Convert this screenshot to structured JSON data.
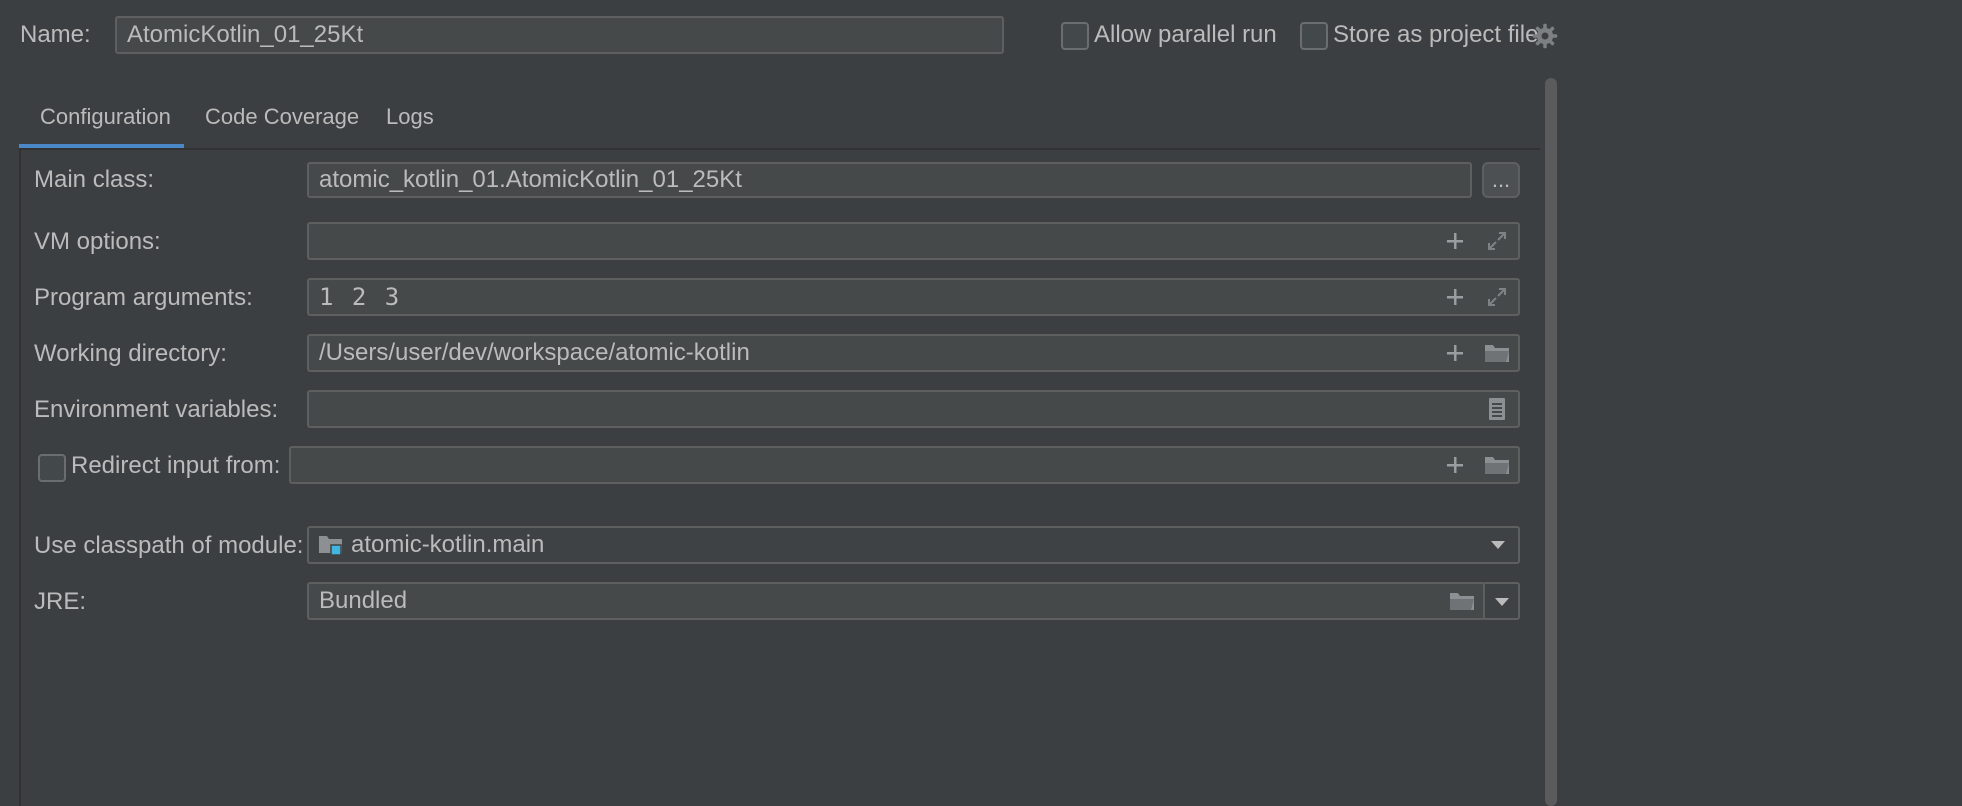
{
  "header": {
    "name_label": "Name:",
    "name_value": "AtomicKotlin_01_25Kt",
    "allow_parallel_label": "Allow parallel run",
    "store_project_label": "Store as project file"
  },
  "tabs": [
    {
      "label": "Configuration",
      "active": true
    },
    {
      "label": "Code Coverage",
      "active": false
    },
    {
      "label": "Logs",
      "active": false
    }
  ],
  "form": {
    "main_class": {
      "label": "Main class:",
      "value": "atomic_kotlin_01.AtomicKotlin_01_25Kt",
      "button": "..."
    },
    "vm_options": {
      "label": "VM options:",
      "value": ""
    },
    "program_arguments": {
      "label": "Program arguments:",
      "value": "1 2 3"
    },
    "working_directory": {
      "label": "Working directory:",
      "value": "/Users/user/dev/workspace/atomic-kotlin"
    },
    "environment_variables": {
      "label": "Environment variables:",
      "value": ""
    },
    "redirect_input": {
      "label": "Redirect input from:",
      "value": ""
    },
    "classpath_module": {
      "label": "Use classpath of module:",
      "value": "atomic-kotlin.main"
    },
    "jre": {
      "label": "JRE:",
      "value": "Bundled"
    }
  },
  "icons": {
    "plus": "plus-icon",
    "expand": "expand-icon",
    "folder": "folder-icon",
    "document": "document-icon",
    "chevron": "chevron-down-icon",
    "gear": "gear-icon",
    "module": "module-folder-icon"
  },
  "colors": {
    "background": "#3c3f41",
    "panel": "#3c3f41",
    "field": "#45494a",
    "accent": "#4a88c7",
    "text": "#bbbbbb"
  }
}
